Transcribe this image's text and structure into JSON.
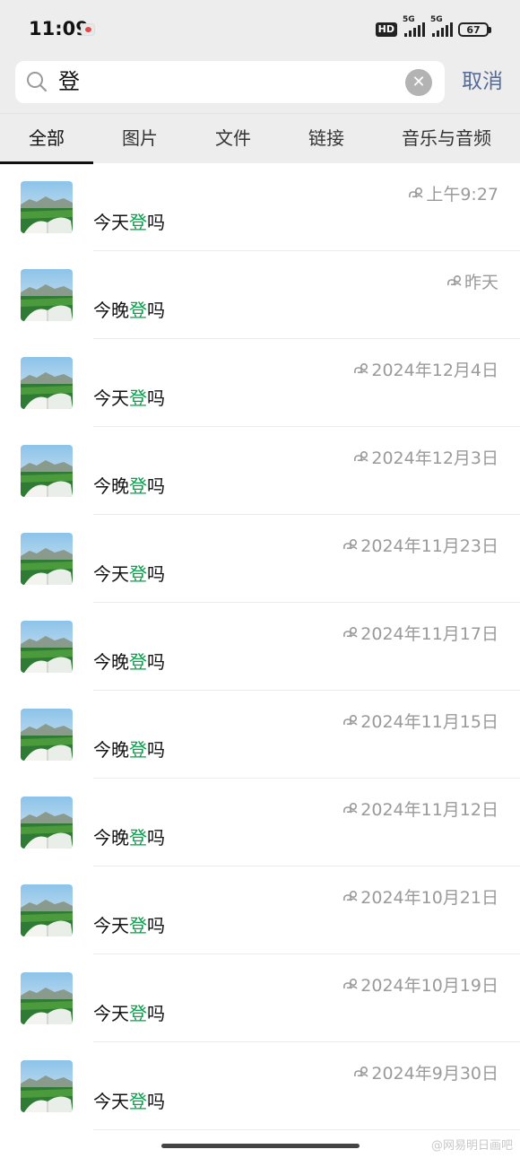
{
  "status_bar": {
    "time": "11:09",
    "hd_label": "HD",
    "signal1_label": "5G",
    "signal2_label": "5G",
    "battery": "67"
  },
  "search": {
    "query": "登",
    "cancel_label": "取消",
    "icons": {
      "search": "search-icon",
      "clear": "clear-icon"
    }
  },
  "tabs": [
    {
      "label": "全部",
      "active": true
    },
    {
      "label": "图片",
      "active": false
    },
    {
      "label": "文件",
      "active": false
    },
    {
      "label": "链接",
      "active": false
    },
    {
      "label": "音乐与音频",
      "active": false
    }
  ],
  "results": [
    {
      "date": "上午9:27",
      "pre": "今天",
      "hit": "登",
      "post": "吗"
    },
    {
      "date": "昨天",
      "pre": "今晚",
      "hit": "登",
      "post": "吗"
    },
    {
      "date": "2024年12月4日",
      "pre": "今天",
      "hit": "登",
      "post": "吗"
    },
    {
      "date": "2024年12月3日",
      "pre": "今晚",
      "hit": "登",
      "post": "吗"
    },
    {
      "date": "2024年11月23日",
      "pre": "今天",
      "hit": "登",
      "post": "吗"
    },
    {
      "date": "2024年11月17日",
      "pre": "今晚",
      "hit": "登",
      "post": "吗"
    },
    {
      "date": "2024年11月15日",
      "pre": "今晚",
      "hit": "登",
      "post": "吗"
    },
    {
      "date": "2024年11月12日",
      "pre": "今晚",
      "hit": "登",
      "post": "吗"
    },
    {
      "date": "2024年10月21日",
      "pre": "今天",
      "hit": "登",
      "post": "吗"
    },
    {
      "date": "2024年10月19日",
      "pre": "今天",
      "hit": "登",
      "post": "吗"
    },
    {
      "date": "2024年9月30日",
      "pre": "今天",
      "hit": "登",
      "post": "吗"
    }
  ],
  "watermark": "@网易明日画吧",
  "colors": {
    "highlight": "#07a04b",
    "cancel": "#576b95",
    "date": "#9a9a9a",
    "header_bg": "#ededed"
  }
}
